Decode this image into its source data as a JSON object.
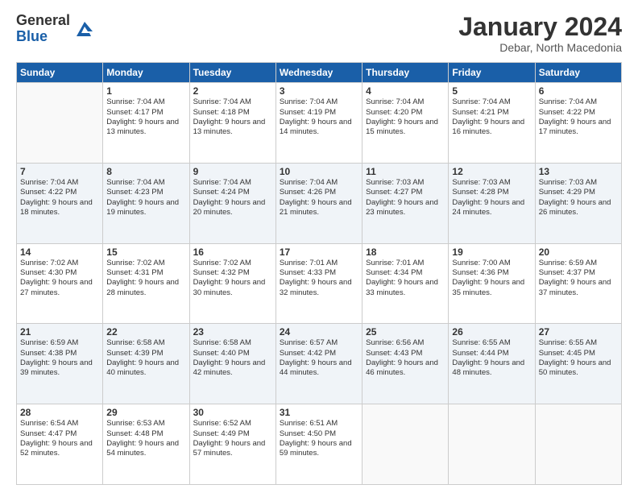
{
  "header": {
    "logo": {
      "line1": "General",
      "line2": "Blue"
    },
    "title": "January 2024",
    "location": "Debar, North Macedonia"
  },
  "weekdays": [
    "Sunday",
    "Monday",
    "Tuesday",
    "Wednesday",
    "Thursday",
    "Friday",
    "Saturday"
  ],
  "weeks": [
    [
      {
        "day": "",
        "empty": true
      },
      {
        "day": "1",
        "sunrise": "Sunrise: 7:04 AM",
        "sunset": "Sunset: 4:17 PM",
        "daylight": "Daylight: 9 hours and 13 minutes."
      },
      {
        "day": "2",
        "sunrise": "Sunrise: 7:04 AM",
        "sunset": "Sunset: 4:18 PM",
        "daylight": "Daylight: 9 hours and 13 minutes."
      },
      {
        "day": "3",
        "sunrise": "Sunrise: 7:04 AM",
        "sunset": "Sunset: 4:19 PM",
        "daylight": "Daylight: 9 hours and 14 minutes."
      },
      {
        "day": "4",
        "sunrise": "Sunrise: 7:04 AM",
        "sunset": "Sunset: 4:20 PM",
        "daylight": "Daylight: 9 hours and 15 minutes."
      },
      {
        "day": "5",
        "sunrise": "Sunrise: 7:04 AM",
        "sunset": "Sunset: 4:21 PM",
        "daylight": "Daylight: 9 hours and 16 minutes."
      },
      {
        "day": "6",
        "sunrise": "Sunrise: 7:04 AM",
        "sunset": "Sunset: 4:22 PM",
        "daylight": "Daylight: 9 hours and 17 minutes."
      }
    ],
    [
      {
        "day": "7",
        "sunrise": "Sunrise: 7:04 AM",
        "sunset": "Sunset: 4:22 PM",
        "daylight": "Daylight: 9 hours and 18 minutes."
      },
      {
        "day": "8",
        "sunrise": "Sunrise: 7:04 AM",
        "sunset": "Sunset: 4:23 PM",
        "daylight": "Daylight: 9 hours and 19 minutes."
      },
      {
        "day": "9",
        "sunrise": "Sunrise: 7:04 AM",
        "sunset": "Sunset: 4:24 PM",
        "daylight": "Daylight: 9 hours and 20 minutes."
      },
      {
        "day": "10",
        "sunrise": "Sunrise: 7:04 AM",
        "sunset": "Sunset: 4:26 PM",
        "daylight": "Daylight: 9 hours and 21 minutes."
      },
      {
        "day": "11",
        "sunrise": "Sunrise: 7:03 AM",
        "sunset": "Sunset: 4:27 PM",
        "daylight": "Daylight: 9 hours and 23 minutes."
      },
      {
        "day": "12",
        "sunrise": "Sunrise: 7:03 AM",
        "sunset": "Sunset: 4:28 PM",
        "daylight": "Daylight: 9 hours and 24 minutes."
      },
      {
        "day": "13",
        "sunrise": "Sunrise: 7:03 AM",
        "sunset": "Sunset: 4:29 PM",
        "daylight": "Daylight: 9 hours and 26 minutes."
      }
    ],
    [
      {
        "day": "14",
        "sunrise": "Sunrise: 7:02 AM",
        "sunset": "Sunset: 4:30 PM",
        "daylight": "Daylight: 9 hours and 27 minutes."
      },
      {
        "day": "15",
        "sunrise": "Sunrise: 7:02 AM",
        "sunset": "Sunset: 4:31 PM",
        "daylight": "Daylight: 9 hours and 28 minutes."
      },
      {
        "day": "16",
        "sunrise": "Sunrise: 7:02 AM",
        "sunset": "Sunset: 4:32 PM",
        "daylight": "Daylight: 9 hours and 30 minutes."
      },
      {
        "day": "17",
        "sunrise": "Sunrise: 7:01 AM",
        "sunset": "Sunset: 4:33 PM",
        "daylight": "Daylight: 9 hours and 32 minutes."
      },
      {
        "day": "18",
        "sunrise": "Sunrise: 7:01 AM",
        "sunset": "Sunset: 4:34 PM",
        "daylight": "Daylight: 9 hours and 33 minutes."
      },
      {
        "day": "19",
        "sunrise": "Sunrise: 7:00 AM",
        "sunset": "Sunset: 4:36 PM",
        "daylight": "Daylight: 9 hours and 35 minutes."
      },
      {
        "day": "20",
        "sunrise": "Sunrise: 6:59 AM",
        "sunset": "Sunset: 4:37 PM",
        "daylight": "Daylight: 9 hours and 37 minutes."
      }
    ],
    [
      {
        "day": "21",
        "sunrise": "Sunrise: 6:59 AM",
        "sunset": "Sunset: 4:38 PM",
        "daylight": "Daylight: 9 hours and 39 minutes."
      },
      {
        "day": "22",
        "sunrise": "Sunrise: 6:58 AM",
        "sunset": "Sunset: 4:39 PM",
        "daylight": "Daylight: 9 hours and 40 minutes."
      },
      {
        "day": "23",
        "sunrise": "Sunrise: 6:58 AM",
        "sunset": "Sunset: 4:40 PM",
        "daylight": "Daylight: 9 hours and 42 minutes."
      },
      {
        "day": "24",
        "sunrise": "Sunrise: 6:57 AM",
        "sunset": "Sunset: 4:42 PM",
        "daylight": "Daylight: 9 hours and 44 minutes."
      },
      {
        "day": "25",
        "sunrise": "Sunrise: 6:56 AM",
        "sunset": "Sunset: 4:43 PM",
        "daylight": "Daylight: 9 hours and 46 minutes."
      },
      {
        "day": "26",
        "sunrise": "Sunrise: 6:55 AM",
        "sunset": "Sunset: 4:44 PM",
        "daylight": "Daylight: 9 hours and 48 minutes."
      },
      {
        "day": "27",
        "sunrise": "Sunrise: 6:55 AM",
        "sunset": "Sunset: 4:45 PM",
        "daylight": "Daylight: 9 hours and 50 minutes."
      }
    ],
    [
      {
        "day": "28",
        "sunrise": "Sunrise: 6:54 AM",
        "sunset": "Sunset: 4:47 PM",
        "daylight": "Daylight: 9 hours and 52 minutes."
      },
      {
        "day": "29",
        "sunrise": "Sunrise: 6:53 AM",
        "sunset": "Sunset: 4:48 PM",
        "daylight": "Daylight: 9 hours and 54 minutes."
      },
      {
        "day": "30",
        "sunrise": "Sunrise: 6:52 AM",
        "sunset": "Sunset: 4:49 PM",
        "daylight": "Daylight: 9 hours and 57 minutes."
      },
      {
        "day": "31",
        "sunrise": "Sunrise: 6:51 AM",
        "sunset": "Sunset: 4:50 PM",
        "daylight": "Daylight: 9 hours and 59 minutes."
      },
      {
        "day": "",
        "empty": true
      },
      {
        "day": "",
        "empty": true
      },
      {
        "day": "",
        "empty": true
      }
    ]
  ]
}
